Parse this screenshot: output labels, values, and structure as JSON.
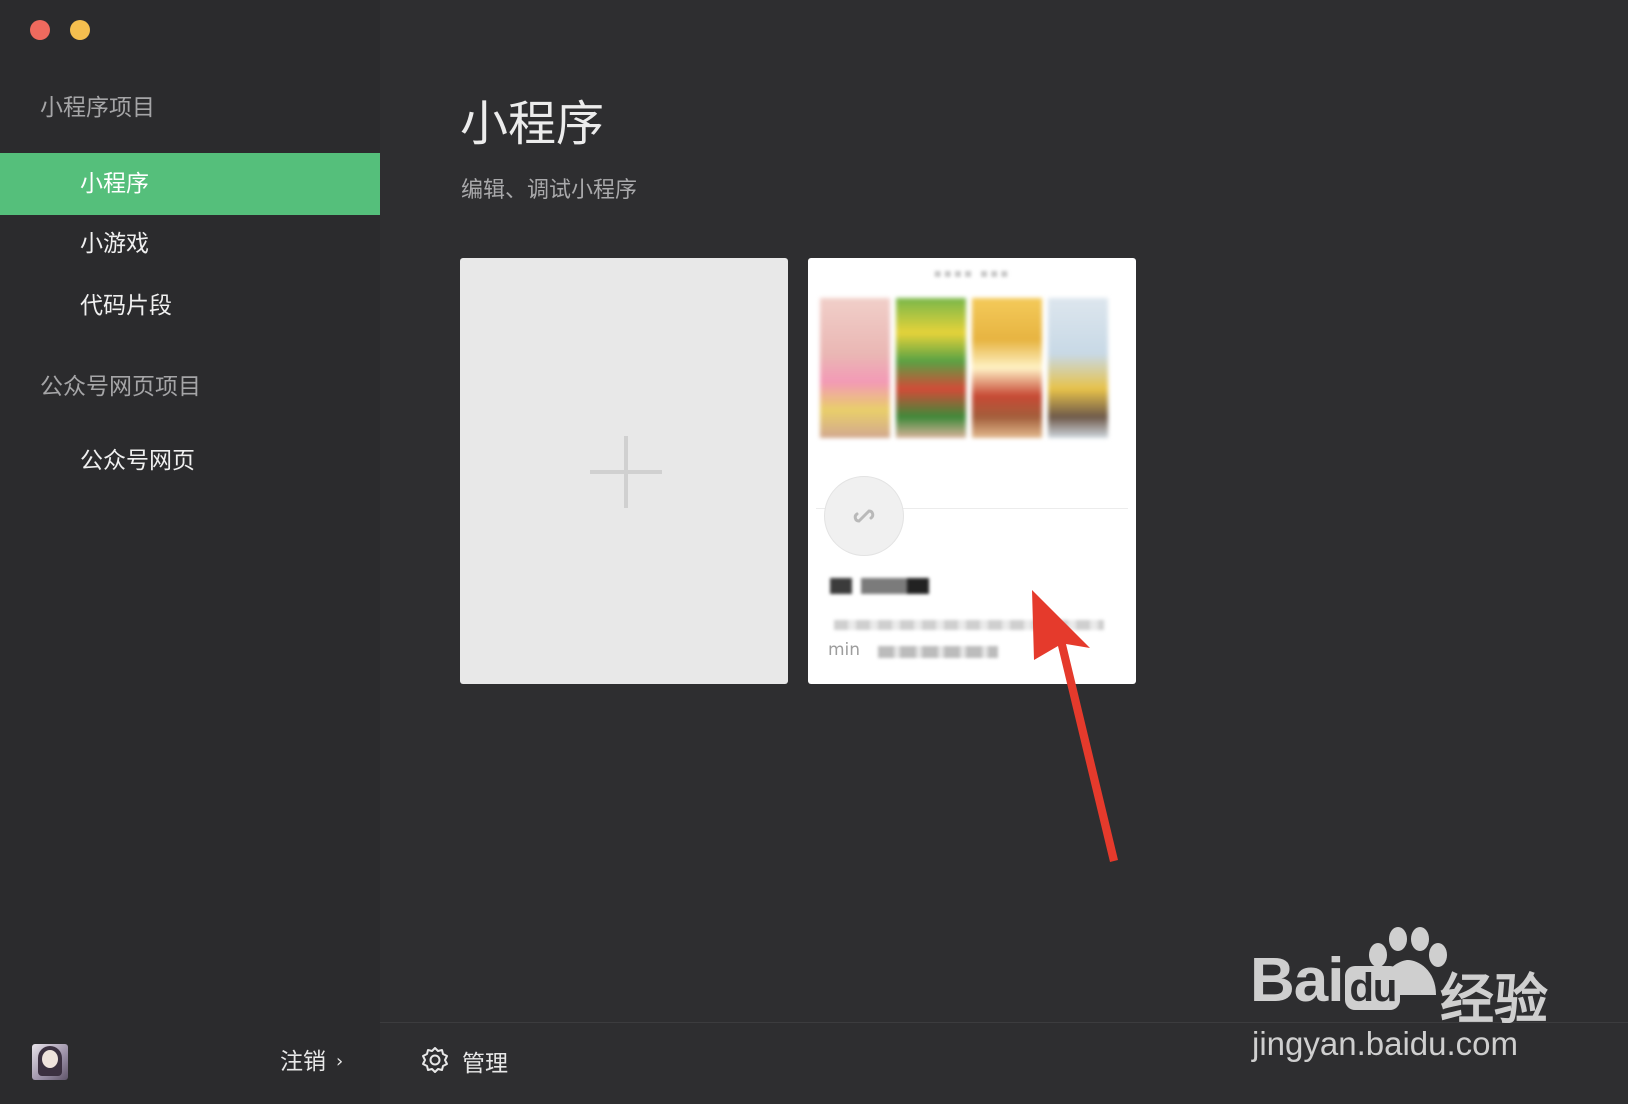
{
  "sidebar": {
    "section1_title": "小程序项目",
    "items1": [
      {
        "label": "小程序",
        "active": true
      },
      {
        "label": "小游戏",
        "active": false
      },
      {
        "label": "代码片段",
        "active": false
      }
    ],
    "section2_title": "公众号网页项目",
    "items2": [
      {
        "label": "公众号网页",
        "active": false
      }
    ],
    "logout_label": "注销",
    "logout_chevron": "›"
  },
  "main": {
    "title": "小程序",
    "subtitle": "编辑、调试小程序",
    "add_card_icon": "plus-icon",
    "project_card": {
      "desc_prefix": "min"
    },
    "manage_label": "管理",
    "manage_icon": "gear-icon"
  },
  "watermark": {
    "logo_text": "Bai",
    "logo_text2": "du",
    "cn_text": "经验",
    "url": "jingyan.baidu.com"
  },
  "colors": {
    "accent": "#55bf7b",
    "sidebar_bg": "#2b2b2d",
    "main_bg": "#2e2e30",
    "arrow": "#e53a2c"
  }
}
